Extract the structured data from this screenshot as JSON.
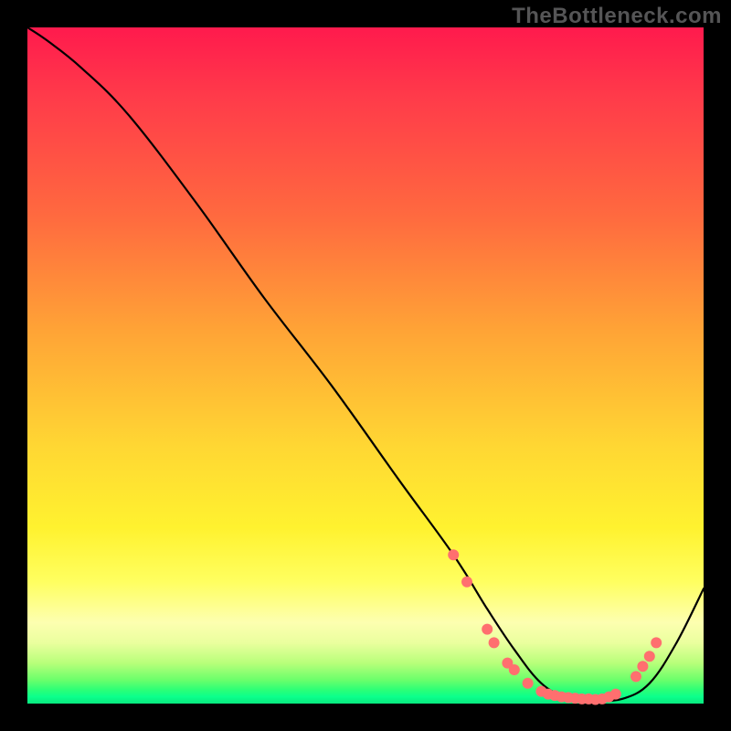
{
  "watermark": "TheBottleneck.com",
  "chart_data": {
    "type": "line",
    "title": "",
    "xlabel": "",
    "ylabel": "",
    "xlim": [
      0,
      100
    ],
    "ylim": [
      0,
      100
    ],
    "grid": false,
    "legend": false,
    "note": "No axis ticks or labels visible; values are relative percentages read off the plot area.",
    "series": [
      {
        "name": "curve",
        "color": "#000000",
        "x": [
          0,
          3,
          8,
          15,
          25,
          35,
          45,
          55,
          63,
          68,
          72,
          76,
          80,
          84,
          88,
          92,
          96,
          100
        ],
        "y": [
          100,
          98,
          94,
          87,
          74,
          60,
          47,
          33,
          22,
          14,
          8,
          3,
          0.8,
          0.5,
          0.7,
          3,
          9,
          17
        ]
      }
    ],
    "markers": [
      {
        "name": "cluster-dots",
        "shape": "circle",
        "color": "#ff6f6f",
        "radius_px": 6,
        "points": [
          {
            "x": 63,
            "y": 22
          },
          {
            "x": 65,
            "y": 18
          },
          {
            "x": 68,
            "y": 11
          },
          {
            "x": 69,
            "y": 9
          },
          {
            "x": 71,
            "y": 6
          },
          {
            "x": 72,
            "y": 5
          },
          {
            "x": 74,
            "y": 3
          },
          {
            "x": 76,
            "y": 1.8
          },
          {
            "x": 77,
            "y": 1.4
          },
          {
            "x": 78,
            "y": 1.2
          },
          {
            "x": 79,
            "y": 1.0
          },
          {
            "x": 80,
            "y": 0.9
          },
          {
            "x": 81,
            "y": 0.8
          },
          {
            "x": 82,
            "y": 0.7
          },
          {
            "x": 83,
            "y": 0.7
          },
          {
            "x": 84,
            "y": 0.6
          },
          {
            "x": 85,
            "y": 0.7
          },
          {
            "x": 86,
            "y": 1.0
          },
          {
            "x": 87,
            "y": 1.4
          },
          {
            "x": 90,
            "y": 4
          },
          {
            "x": 91,
            "y": 5.5
          },
          {
            "x": 92,
            "y": 7
          },
          {
            "x": 93,
            "y": 9
          }
        ]
      }
    ]
  }
}
